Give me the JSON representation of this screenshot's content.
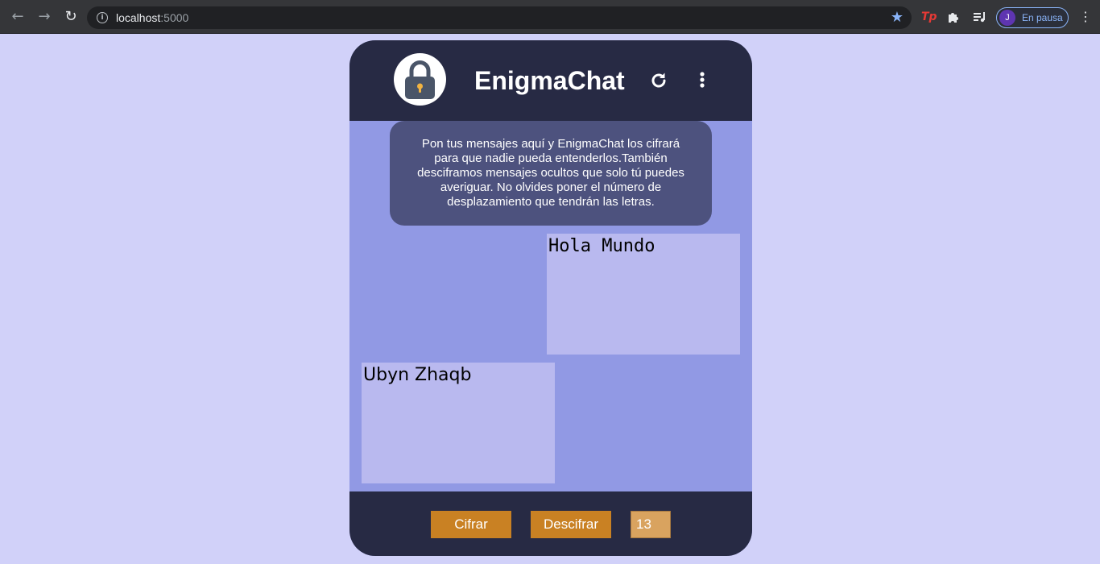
{
  "browser": {
    "url_host": "localhost",
    "url_port": ":5000",
    "profile_initial": "J",
    "profile_status": "En pausa",
    "ext_tp_label": "Tp"
  },
  "app": {
    "title": "EnigmaChat",
    "intro_text": "Pon tus mensajes aquí y EnigmaChat los cifrará para que nadie pueda entenderlos.También desciframos mensajes ocultos que solo tú puedes averiguar. No olvides poner el número de desplazamiento que tendrán las letras.",
    "input_message": "Hola Mundo",
    "output_message": "Ubyn Zhaqb",
    "encrypt_label": "Cifrar",
    "decrypt_label": "Descifrar",
    "offset_value": "13"
  },
  "icons": {
    "back": "arrow-left-icon",
    "forward": "arrow-right-icon",
    "reload": "reload-icon",
    "info": "info-icon",
    "bookmark": "star-icon",
    "extensions": "puzzle-icon",
    "media": "media-queue-icon",
    "chrome_menu": "kebab-menu-icon",
    "logo": "padlock-icon",
    "refresh": "refresh-icon",
    "app_menu": "vertical-dots-icon"
  },
  "colors": {
    "page_bg": "#d1d1f9",
    "card_body": "#9199e4",
    "header_footer": "#272a44",
    "intro_bg": "#4d527e",
    "message_box": "#b9b9ef",
    "button": "#c98123",
    "offset_field": "#d9a35f"
  }
}
